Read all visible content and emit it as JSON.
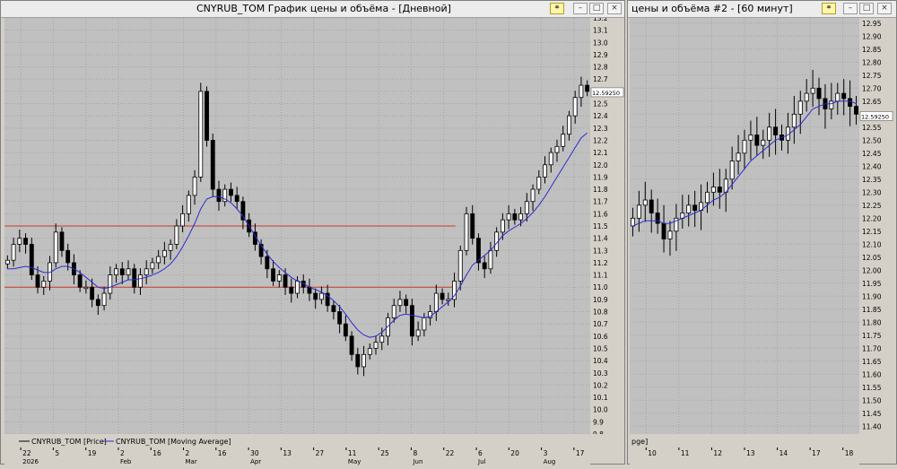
{
  "window1": {
    "title": "CNYRUB_TOM График цены и объёма - [Дневной]",
    "buttons": [
      "link-icon",
      "minimize-icon",
      "maximize-icon",
      "close-icon"
    ],
    "legend": [
      "CNYRUB_TOM [Price]",
      "CNYRUB_TOM [Moving Average]"
    ]
  },
  "window2": {
    "title": "цены и объёма #2 - [60 минут]",
    "buttons": [
      "link-icon",
      "minimize-icon",
      "maximize-icon",
      "close-icon"
    ],
    "legend_fragment": "pge]"
  },
  "colors": {
    "price": "#000000",
    "ma": "#2b2bd0",
    "hline": "#c83a2a",
    "plot_bg": "#c0c0c0"
  },
  "chart_data": [
    {
      "type": "candlestick",
      "name": "daily",
      "ylim": [
        9.8,
        13.2
      ],
      "y_ticks": [
        "13.2",
        "13.1",
        "13.0",
        "12.9",
        "12.8",
        "12.7",
        "12.6",
        "12.5",
        "12.4",
        "12.3",
        "12.2",
        "12.1",
        "12.0",
        "11.9",
        "11.8",
        "11.7",
        "11.6",
        "11.5",
        "11.4",
        "11.3",
        "11.2",
        "11.1",
        "11.0",
        "10.9",
        "10.8",
        "10.7",
        "10.6",
        "10.5",
        "10.4",
        "10.3",
        "10.2",
        "10.1",
        "10.0",
        "9.9",
        "9.8"
      ],
      "last_price_label": "12.59250",
      "last_price": 12.5925,
      "x_ticks": [
        {
          "label": "22",
          "sub": "2026"
        },
        {
          "label": "5",
          "sub": ""
        },
        {
          "label": "19",
          "sub": ""
        },
        {
          "label": "2",
          "sub": "Feb"
        },
        {
          "label": "16",
          "sub": ""
        },
        {
          "label": "2",
          "sub": "Mar"
        },
        {
          "label": "16",
          "sub": ""
        },
        {
          "label": "30",
          "sub": "Apr"
        },
        {
          "label": "13",
          "sub": ""
        },
        {
          "label": "27",
          "sub": ""
        },
        {
          "label": "11",
          "sub": "May"
        },
        {
          "label": "25",
          "sub": ""
        },
        {
          "label": "8",
          "sub": "Jun"
        },
        {
          "label": "22",
          "sub": ""
        },
        {
          "label": "6",
          "sub": "Jul"
        },
        {
          "label": "20",
          "sub": ""
        },
        {
          "label": "3",
          "sub": "Aug"
        },
        {
          "label": "17",
          "sub": ""
        }
      ],
      "horizontal_lines": [
        11.5,
        11.0
      ],
      "close": [
        11.22,
        11.35,
        11.4,
        11.35,
        11.1,
        11.0,
        11.05,
        11.2,
        11.45,
        11.3,
        11.2,
        11.1,
        11.0,
        11.0,
        10.9,
        10.85,
        10.95,
        11.1,
        11.15,
        11.1,
        11.15,
        11.0,
        11.1,
        11.15,
        11.2,
        11.25,
        11.3,
        11.35,
        11.5,
        11.6,
        11.75,
        11.9,
        12.6,
        12.2,
        11.8,
        11.7,
        11.8,
        11.75,
        11.7,
        11.55,
        11.45,
        11.35,
        11.25,
        11.15,
        11.05,
        11.1,
        11.0,
        10.95,
        11.05,
        11.0,
        10.95,
        10.9,
        10.95,
        10.85,
        10.8,
        10.7,
        10.6,
        10.45,
        10.35,
        10.45,
        10.5,
        10.55,
        10.6,
        10.75,
        10.85,
        10.9,
        10.85,
        10.6,
        10.65,
        10.75,
        10.8,
        10.95,
        10.9,
        10.9,
        11.05,
        11.3,
        11.6,
        11.4,
        11.2,
        11.15,
        11.3,
        11.45,
        11.55,
        11.6,
        11.55,
        11.6,
        11.7,
        11.8,
        11.9,
        12.0,
        12.1,
        12.15,
        12.25,
        12.4,
        12.55,
        12.65,
        12.6
      ],
      "ma": [
        11.15,
        11.15,
        11.16,
        11.17,
        11.16,
        11.14,
        11.12,
        11.12,
        11.15,
        11.17,
        11.17,
        11.15,
        11.12,
        11.08,
        11.04,
        11.0,
        10.99,
        11.0,
        11.02,
        11.04,
        11.06,
        11.06,
        11.07,
        11.08,
        11.1,
        11.12,
        11.15,
        11.19,
        11.25,
        11.33,
        11.42,
        11.52,
        11.64,
        11.72,
        11.74,
        11.74,
        11.72,
        11.69,
        11.64,
        11.58,
        11.5,
        11.42,
        11.34,
        11.27,
        11.21,
        11.16,
        11.12,
        11.08,
        11.05,
        11.03,
        11.0,
        10.98,
        10.96,
        10.93,
        10.89,
        10.84,
        10.78,
        10.71,
        10.65,
        10.61,
        10.59,
        10.6,
        10.63,
        10.68,
        10.73,
        10.77,
        10.78,
        10.77,
        10.76,
        10.75,
        10.76,
        10.8,
        10.84,
        10.88,
        10.93,
        11.01,
        11.1,
        11.18,
        11.22,
        11.26,
        11.3,
        11.36,
        11.42,
        11.46,
        11.49,
        11.52,
        11.56,
        11.61,
        11.67,
        11.74,
        11.82,
        11.9,
        11.98,
        12.06,
        12.14,
        12.22,
        12.26
      ]
    },
    {
      "type": "candlestick",
      "name": "hourly",
      "ylim": [
        11.37,
        12.97
      ],
      "y_ticks": [
        "12.95",
        "12.90",
        "12.85",
        "12.80",
        "12.75",
        "12.70",
        "12.65",
        "12.60",
        "12.55",
        "12.50",
        "12.45",
        "12.40",
        "12.35",
        "12.30",
        "12.25",
        "12.20",
        "12.15",
        "12.10",
        "12.05",
        "12.00",
        "11.95",
        "11.90",
        "11.85",
        "11.80",
        "11.75",
        "11.70",
        "11.65",
        "11.60",
        "11.55",
        "11.50",
        "11.45",
        "11.40"
      ],
      "last_price_label": "12.59250",
      "last_price": 12.5925,
      "x_ticks": [
        "10",
        "11",
        "12",
        "13",
        "14",
        "17",
        "18"
      ],
      "close": [
        12.2,
        12.25,
        12.27,
        12.22,
        12.18,
        12.12,
        12.15,
        12.2,
        12.22,
        12.25,
        12.23,
        12.26,
        12.3,
        12.32,
        12.3,
        12.35,
        12.42,
        12.45,
        12.5,
        12.52,
        12.48,
        12.5,
        12.55,
        12.52,
        12.5,
        12.55,
        12.6,
        12.65,
        12.68,
        12.7,
        12.66,
        12.62,
        12.65,
        12.68,
        12.66,
        12.63,
        12.6
      ],
      "ma": [
        12.17,
        12.18,
        12.19,
        12.19,
        12.19,
        12.18,
        12.18,
        12.19,
        12.2,
        12.21,
        12.22,
        12.23,
        12.25,
        12.27,
        12.28,
        12.3,
        12.33,
        12.36,
        12.39,
        12.42,
        12.44,
        12.46,
        12.48,
        12.5,
        12.51,
        12.52,
        12.54,
        12.56,
        12.59,
        12.62,
        12.63,
        12.64,
        12.64,
        12.65,
        12.65,
        12.65,
        12.64
      ]
    }
  ]
}
